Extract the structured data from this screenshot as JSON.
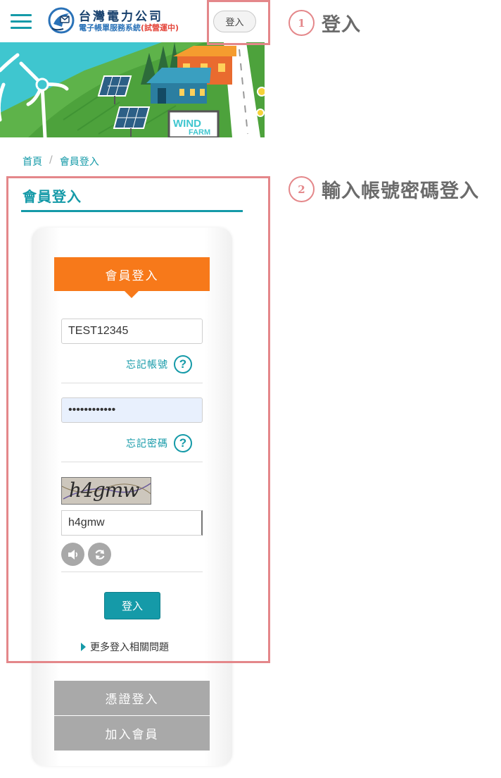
{
  "header": {
    "logo_title": "台灣電力公司",
    "logo_subtitle": "電子帳單服務系統",
    "logo_trial": "(試營運中)",
    "login_button": "登入"
  },
  "banner": {
    "sign_line1": "WIND",
    "sign_line2": "FARM"
  },
  "breadcrumb": {
    "home": "首頁",
    "separator": "/",
    "current": "會員登入"
  },
  "page": {
    "title": "會員登入"
  },
  "form": {
    "header": "會員登入",
    "account_value": "TEST12345",
    "forgot_account": "忘記帳號",
    "password_value": "••••••••••••",
    "forgot_password": "忘記密碼",
    "help_glyph": "?",
    "captcha_image_text": "h4gmw",
    "captcha_value": "h4gmw",
    "submit_label": "登入",
    "more_link": "更多登入相關問題",
    "certificate_login": "憑證登入",
    "join_member": "加入會員"
  },
  "annotations": {
    "step1_number": "1",
    "step1_label": "登入",
    "step2_number": "2",
    "step2_label": "輸入帳號密碼登入"
  },
  "colors": {
    "brand_teal": "#159aa8",
    "orange": "#f7791a",
    "annotation_red": "#e4878a",
    "gray_button": "#a9a9a9"
  },
  "icons": {
    "menu": "hamburger-menu-icon",
    "logo": "taipower-logo-icon",
    "help": "question-circle-icon",
    "audio": "speaker-icon",
    "refresh": "refresh-icon",
    "bullet": "triangle-right-icon"
  }
}
